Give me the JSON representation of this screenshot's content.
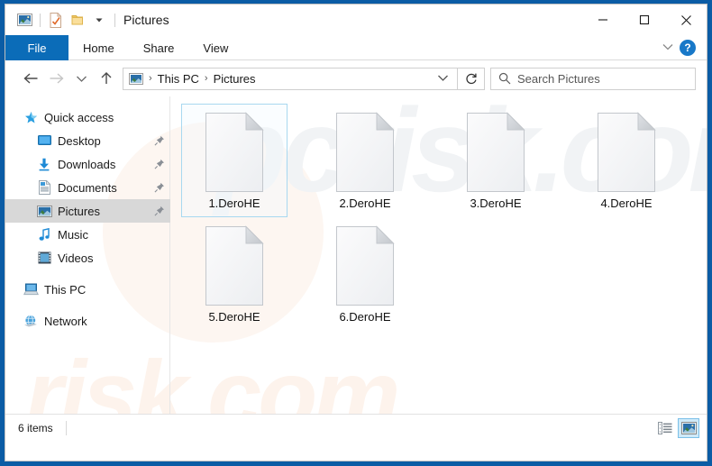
{
  "window": {
    "title": "Pictures",
    "accent_blue": "#0b5ca5",
    "tab_active_blue": "#0b6cb8",
    "selection_border": "#a8d8f0"
  },
  "quick_access_toolbar": {
    "items": [
      {
        "name": "pictures-folder-icon",
        "label": "Pictures"
      },
      {
        "name": "properties-icon",
        "label": "Properties"
      },
      {
        "name": "new-folder-icon",
        "label": "New folder"
      },
      {
        "name": "customize-dropdown-icon",
        "label": "Customize Quick Access Toolbar"
      }
    ]
  },
  "window_controls": {
    "minimize": "Minimize",
    "maximize": "Maximize",
    "close": "Close"
  },
  "ribbon": {
    "tabs": [
      {
        "label": "File",
        "active": true
      },
      {
        "label": "Home",
        "active": false
      },
      {
        "label": "Share",
        "active": false
      },
      {
        "label": "View",
        "active": false
      }
    ],
    "collapse_label": "Minimize the Ribbon",
    "help_label": "?"
  },
  "navigation": {
    "back": "Back",
    "forward": "Forward",
    "recent": "Recent locations",
    "up": "Up to This PC"
  },
  "address_bar": {
    "crumbs": [
      "This PC",
      "Pictures"
    ],
    "separator": "›",
    "dropdown_label": "Previous locations",
    "refresh_label": "Refresh"
  },
  "search": {
    "placeholder": "Search Pictures",
    "value": ""
  },
  "sidebar": {
    "items": [
      {
        "label": "Quick access",
        "icon": "star-icon",
        "level": 0,
        "pinned": false,
        "selected": false
      },
      {
        "label": "Desktop",
        "icon": "desktop-icon",
        "level": 1,
        "pinned": true,
        "selected": false
      },
      {
        "label": "Downloads",
        "icon": "downloads-icon",
        "level": 1,
        "pinned": true,
        "selected": false
      },
      {
        "label": "Documents",
        "icon": "documents-icon",
        "level": 1,
        "pinned": true,
        "selected": false
      },
      {
        "label": "Pictures",
        "icon": "pictures-icon",
        "level": 1,
        "pinned": true,
        "selected": true
      },
      {
        "label": "Music",
        "icon": "music-icon",
        "level": 1,
        "pinned": false,
        "selected": false
      },
      {
        "label": "Videos",
        "icon": "videos-icon",
        "level": 1,
        "pinned": false,
        "selected": false
      },
      {
        "label": "This PC",
        "icon": "this-pc-icon",
        "level": 0,
        "pinned": false,
        "selected": false
      },
      {
        "label": "Network",
        "icon": "network-icon",
        "level": 0,
        "pinned": false,
        "selected": false
      }
    ]
  },
  "files": [
    {
      "name": "1.DeroHE",
      "icon": "blank-document-icon",
      "selected": true
    },
    {
      "name": "2.DeroHE",
      "icon": "blank-document-icon",
      "selected": false
    },
    {
      "name": "3.DeroHE",
      "icon": "blank-document-icon",
      "selected": false
    },
    {
      "name": "4.DeroHE",
      "icon": "blank-document-icon",
      "selected": false
    },
    {
      "name": "5.DeroHE",
      "icon": "blank-document-icon",
      "selected": false
    },
    {
      "name": "6.DeroHE",
      "icon": "blank-document-icon",
      "selected": false
    }
  ],
  "status_bar": {
    "count_text": "6 items",
    "views": [
      {
        "name": "details-view",
        "label": "Details view",
        "active": false
      },
      {
        "name": "large-icons-view",
        "label": "Large icons view",
        "active": true
      }
    ]
  },
  "watermark": {
    "top": "pcrisk.com",
    "bottom": "risk.com"
  }
}
